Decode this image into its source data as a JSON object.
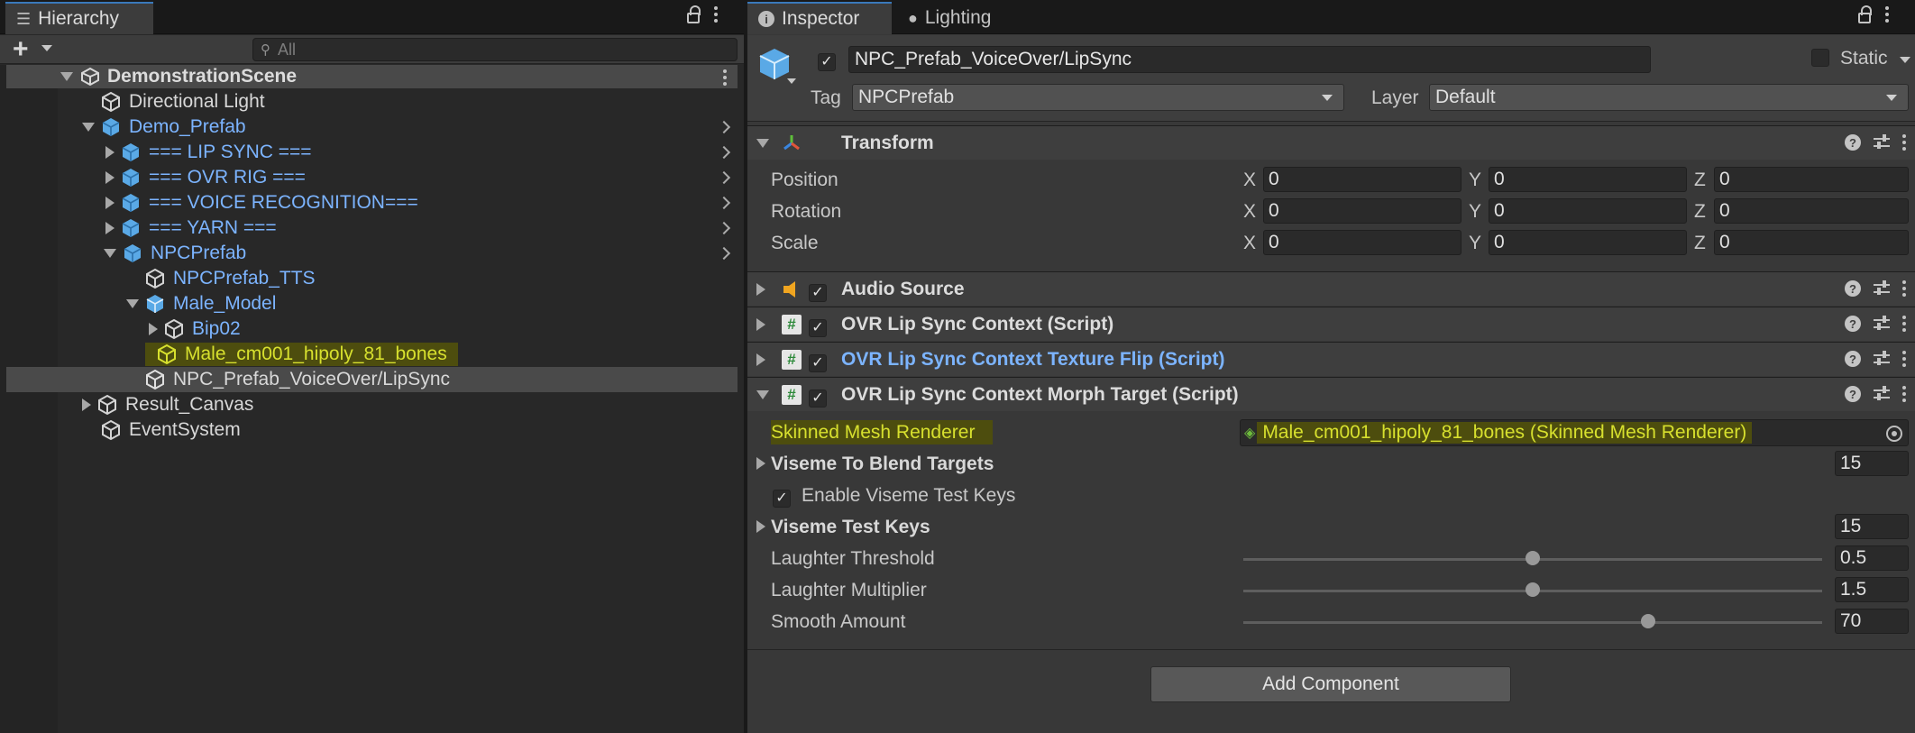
{
  "hierarchy": {
    "tab_label": "Hierarchy",
    "search_placeholder": "All",
    "scene_name": "DemonstrationScene",
    "items": [
      {
        "label": "Directional Light"
      },
      {
        "label": "Demo_Prefab"
      },
      {
        "label": "=== LIP SYNC ==="
      },
      {
        "label": "=== OVR RIG ==="
      },
      {
        "label": "=== VOICE RECOGNITION==="
      },
      {
        "label": "=== YARN ==="
      },
      {
        "label": "NPCPrefab"
      },
      {
        "label": "NPCPrefab_TTS"
      },
      {
        "label": "Male_Model"
      },
      {
        "label": "Bip02"
      },
      {
        "label": "Male_cm001_hipoly_81_bones"
      },
      {
        "label": "NPC_Prefab_VoiceOver/LipSync"
      },
      {
        "label": "Result_Canvas"
      },
      {
        "label": "EventSystem"
      }
    ]
  },
  "inspector": {
    "tab_inspector": "Inspector",
    "tab_lighting": "Lighting",
    "object_name": "NPC_Prefab_VoiceOver/LipSync",
    "static_label": "Static",
    "tag_label": "Tag",
    "tag_value": "NPCPrefab",
    "layer_label": "Layer",
    "layer_value": "Default",
    "transform": {
      "title": "Transform",
      "position_label": "Position",
      "rotation_label": "Rotation",
      "scale_label": "Scale",
      "x": "X",
      "y": "Y",
      "z": "Z",
      "position": [
        "0",
        "0",
        "0"
      ],
      "rotation": [
        "0",
        "0",
        "0"
      ],
      "scale": [
        "0",
        "0",
        "0"
      ]
    },
    "components": [
      {
        "title": "Audio Source"
      },
      {
        "title": "OVR Lip Sync Context (Script)"
      },
      {
        "title": "OVR Lip Sync Context Texture Flip (Script)"
      },
      {
        "title": "OVR Lip Sync Context Morph Target (Script)"
      }
    ],
    "morph": {
      "skinned_label": "Skinned Mesh Renderer",
      "skinned_value": "Male_cm001_hipoly_81_bones (Skinned Mesh Renderer)",
      "viseme_blend_label": "Viseme To Blend Targets",
      "viseme_blend_value": "15",
      "enable_test_keys_label": "Enable Viseme Test Keys",
      "test_keys_label": "Viseme Test Keys",
      "test_keys_value": "15",
      "laughter_threshold_label": "Laughter Threshold",
      "laughter_threshold_value": "0.5",
      "laughter_threshold_fraction": 0.5,
      "laughter_multiplier_label": "Laughter Multiplier",
      "laughter_multiplier_value": "1.5",
      "laughter_multiplier_fraction": 0.5,
      "smooth_amount_label": "Smooth Amount",
      "smooth_amount_value": "70",
      "smooth_amount_fraction": 0.7
    },
    "add_component_label": "Add Component"
  },
  "colors": {
    "accent_blue": "#7cb4ff",
    "highlight_yellow": "#d7e02e",
    "highlight_bg": "#4d4d0e"
  }
}
